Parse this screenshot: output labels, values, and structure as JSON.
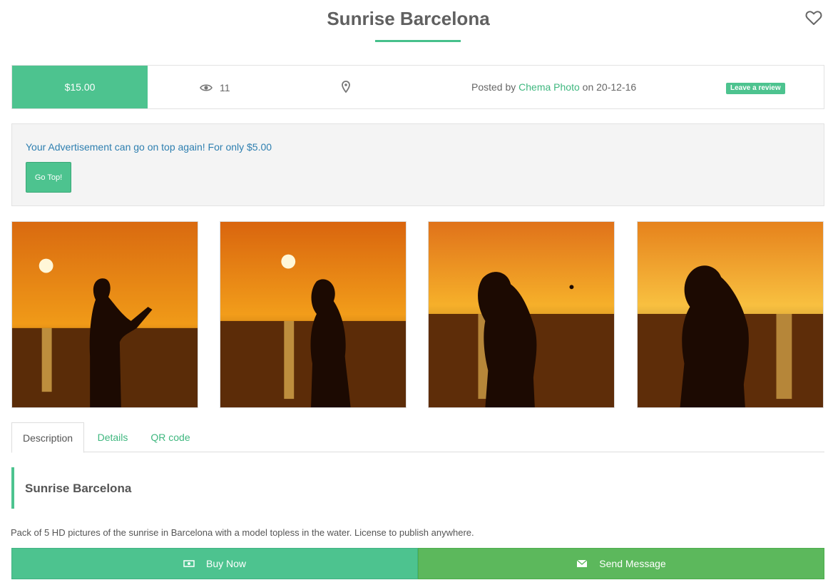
{
  "header": {
    "title": "Sunrise Barcelona",
    "favorite_icon": "heart-outline-icon"
  },
  "info": {
    "price": "$15.00",
    "views_icon": "eye-icon",
    "views": "11",
    "location_icon": "map-pin-icon",
    "posted_prefix": "Posted by",
    "author": "Chema Photo",
    "posted_suffix": "on 20-12-16",
    "review_label": "Leave a review"
  },
  "promo": {
    "text": "Your Advertisement can go on top again! For only $5.00",
    "button": "Go Top!"
  },
  "gallery": {
    "image_count": 4
  },
  "tabs": [
    {
      "label": "Description",
      "active": true
    },
    {
      "label": "Details",
      "active": false
    },
    {
      "label": "QR code",
      "active": false
    }
  ],
  "description": {
    "title": "Sunrise Barcelona",
    "text": "Pack of 5 HD pictures of the sunrise in Barcelona with a model topless in the water. License to publish anywhere."
  },
  "actions": {
    "buy_icon": "money-icon",
    "buy_label": "Buy Now",
    "message_icon": "envelope-icon",
    "message_label": "Send Message"
  },
  "colors": {
    "accent": "#4dc38f",
    "success": "#5cb85c",
    "link": "#2e7fb0"
  }
}
